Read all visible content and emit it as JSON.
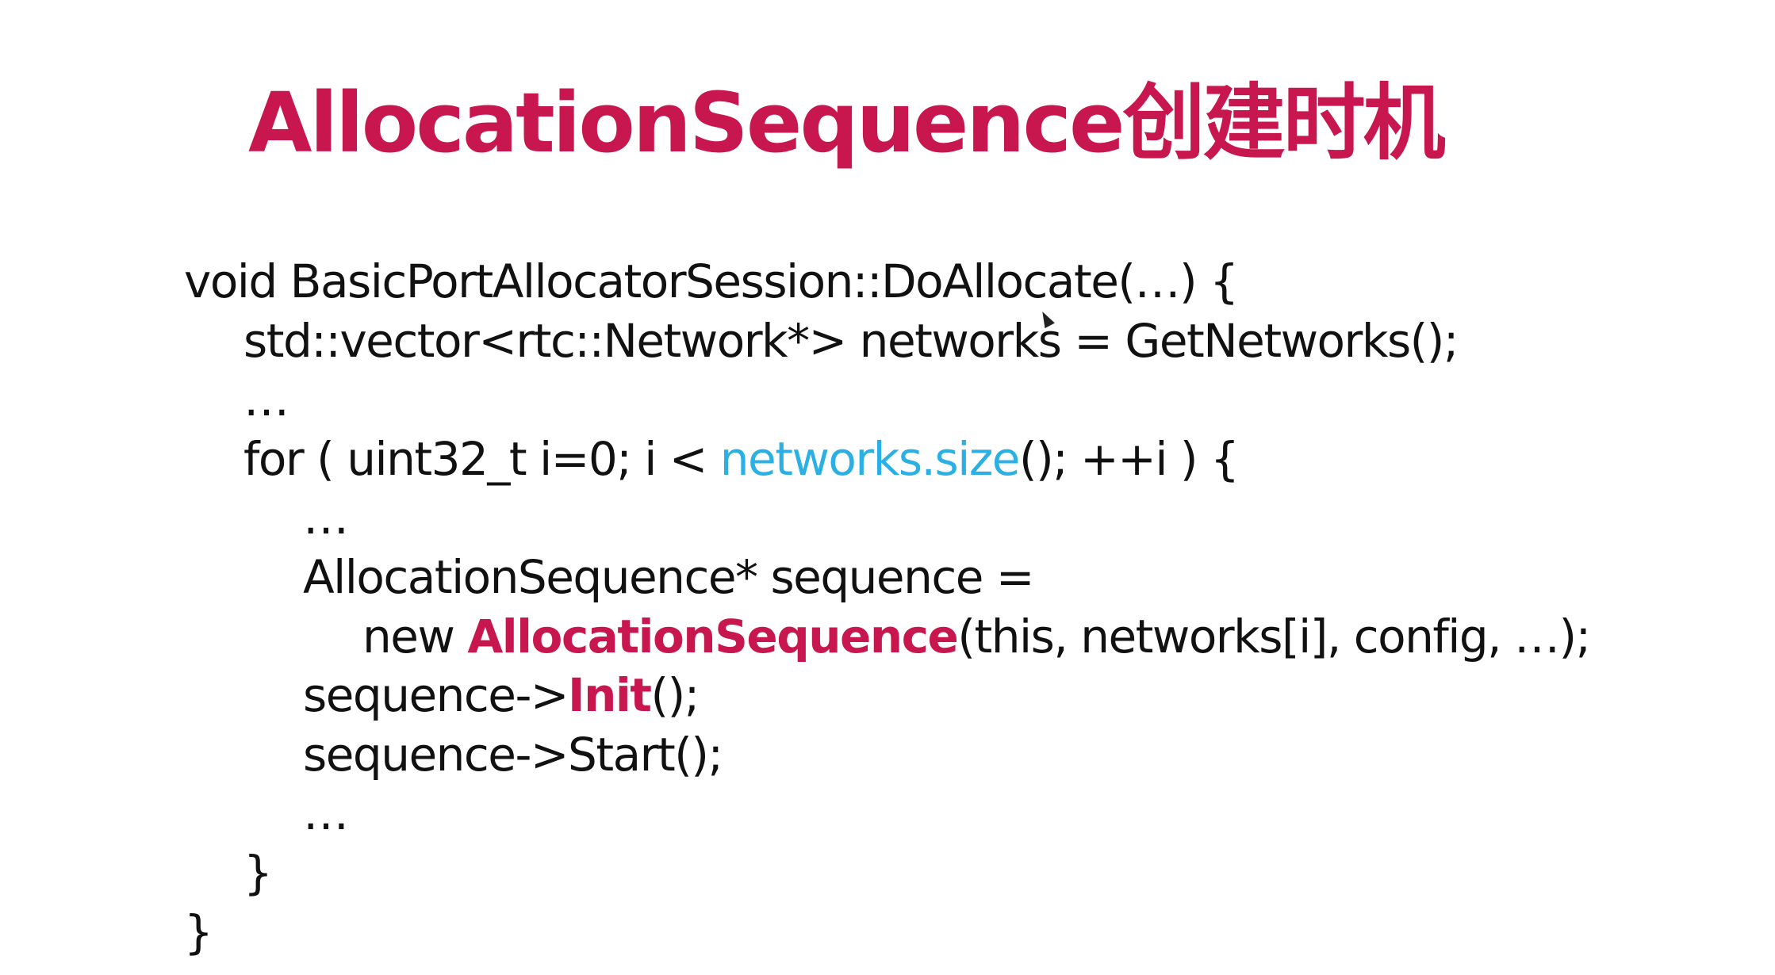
{
  "slide": {
    "title": "AllocationSequence创建时机",
    "title_color": "#c8174f",
    "highlight_cyan": "#2ab0e4",
    "highlight_red": "#c8174f",
    "code_lines": [
      {
        "indent": 0,
        "tokens": [
          {
            "text": "void BasicPortAllocatorSession::DoAllocate(…) {"
          }
        ]
      },
      {
        "indent": 1,
        "tokens": [
          {
            "text": "std::vector<rtc::Network*> networks = GetNetworks();"
          }
        ]
      },
      {
        "indent": 1,
        "tokens": [
          {
            "text": "…"
          }
        ]
      },
      {
        "indent": 1,
        "tokens": [
          {
            "text": "for ( uint32_t i=0; i < "
          },
          {
            "text": "networks.size",
            "color": "#2ab0e4"
          },
          {
            "text": "(); ++i ) {"
          }
        ]
      },
      {
        "indent": 2,
        "tokens": [
          {
            "text": "…"
          }
        ]
      },
      {
        "indent": 2,
        "tokens": [
          {
            "text": "AllocationSequence* sequence ="
          }
        ]
      },
      {
        "indent": 3,
        "tokens": [
          {
            "text": "new "
          },
          {
            "text": "AllocationSequence",
            "color": "#c8174f",
            "bold": true
          },
          {
            "text": "(this, networks[i], config, …);"
          }
        ]
      },
      {
        "indent": 2,
        "tokens": [
          {
            "text": "sequence->"
          },
          {
            "text": "Init",
            "color": "#c8174f",
            "bold": true
          },
          {
            "text": "();"
          }
        ]
      },
      {
        "indent": 2,
        "tokens": [
          {
            "text": "sequence->Start();"
          }
        ]
      },
      {
        "indent": 2,
        "tokens": [
          {
            "text": "…"
          }
        ]
      },
      {
        "indent": 1,
        "tokens": [
          {
            "text": "}"
          }
        ]
      },
      {
        "indent": 0,
        "tokens": [
          {
            "text": "}"
          }
        ]
      }
    ]
  }
}
